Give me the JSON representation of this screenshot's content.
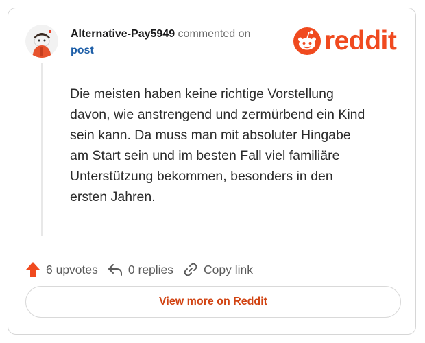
{
  "header": {
    "username": "Alternative-Pay5949",
    "action_text": "commented on",
    "post_link": "post"
  },
  "brand": {
    "wordmark": "reddit",
    "logo_icon": "reddit-snoo-icon",
    "accent_color": "#f04a1f"
  },
  "comment": {
    "text": "Die meisten haben keine richtige Vorstellung\ndavon, wie anstrengend und zermürbend ein Kind\nsein kann. Da muss man mit absoluter Hingabe\nam Start sein und im besten Fall viel familiäre\nUnterstützung bekommen, besonders in den\nersten Jahren."
  },
  "footer": {
    "upvotes": "6 upvotes",
    "replies": "0 replies",
    "copy_link": "Copy link"
  },
  "cta": {
    "label": "View more on Reddit"
  },
  "colors": {
    "link_blue": "#1e5fa8",
    "upvote_orange": "#f04a1f",
    "cta_text": "#d14413"
  }
}
